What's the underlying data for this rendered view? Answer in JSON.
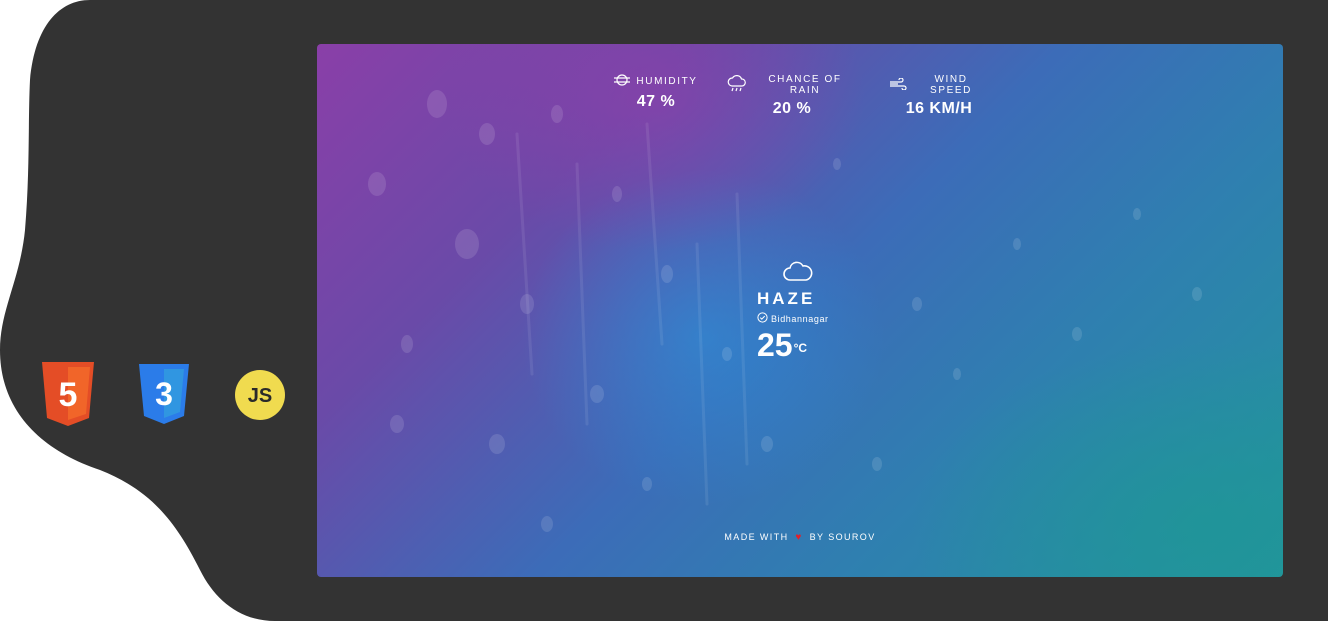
{
  "tech_badges": {
    "html_number": "5",
    "css_number": "3",
    "js_label": "JS"
  },
  "colors": {
    "dark_frame": "#333333",
    "html_badge": "#e44d26",
    "css_badge": "#2b7ce9",
    "js_badge": "#f0db4f",
    "heart": "#e0202a",
    "accent_text": "#ffffff"
  },
  "stats": [
    {
      "icon": "humidity-icon",
      "label": "HUMIDITY",
      "value": "47 %"
    },
    {
      "icon": "rain-cloud-icon",
      "label": "CHANCE OF RAIN",
      "value": "20 %"
    },
    {
      "icon": "wind-icon",
      "label": "WIND SPEED",
      "value": "16 KM/H"
    }
  ],
  "weather": {
    "icon": "cloud-icon",
    "condition": "HAZE",
    "location_icon": "location-check-icon",
    "location": "Bidhannagar",
    "temperature": "25",
    "unit": "°C"
  },
  "footer": {
    "prefix": "MADE WITH",
    "heart_icon": "heart-icon",
    "heart": "♥",
    "suffix": "BY SOUROV"
  }
}
